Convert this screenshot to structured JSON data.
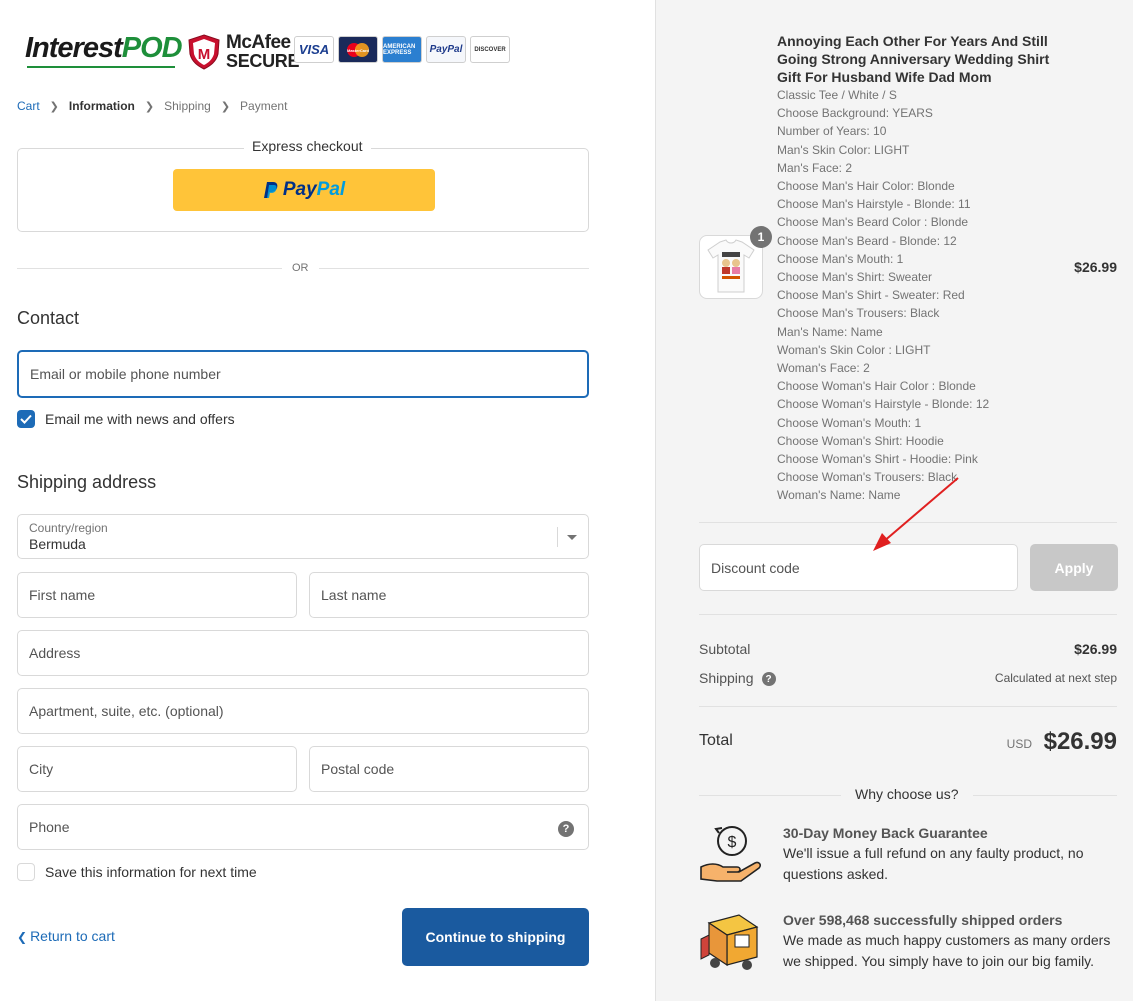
{
  "header": {
    "logo_main": "Interest",
    "logo_accent": "POD",
    "security_badge_line1": "McAfee",
    "security_badge_line2": "SECURE",
    "payment_cards": [
      "VISA",
      "MasterCard",
      "AMERICAN EXPRESS",
      "PayPal",
      "DISCOVER"
    ]
  },
  "breadcrumb": [
    {
      "label": "Cart",
      "state": "link"
    },
    {
      "label": "Information",
      "state": "active"
    },
    {
      "label": "Shipping",
      "state": "inactive"
    },
    {
      "label": "Payment",
      "state": "inactive"
    }
  ],
  "express": {
    "title": "Express checkout",
    "paypal_part1": "Pay",
    "paypal_part2": "Pal",
    "or_text": "OR"
  },
  "contact": {
    "title": "Contact",
    "email_placeholder": "Email or mobile phone number",
    "news_label": "Email me with news and offers",
    "news_checked": true
  },
  "shipping": {
    "title": "Shipping address",
    "country_label": "Country/region",
    "country_value": "Bermuda",
    "first_name_placeholder": "First name",
    "last_name_placeholder": "Last name",
    "address_placeholder": "Address",
    "apartment_placeholder": "Apartment, suite, etc. (optional)",
    "city_placeholder": "City",
    "postal_placeholder": "Postal code",
    "phone_placeholder": "Phone",
    "save_label": "Save this information for next time",
    "save_checked": false
  },
  "footer_actions": {
    "return_label": "Return to cart",
    "continue_label": "Continue to shipping"
  },
  "order": {
    "quantity": "1",
    "product_name": "Annoying Each Other For Years And Still Going Strong Anniversary Wedding Shirt Gift For Husband Wife Dad Mom",
    "variant_lines": [
      "Classic Tee / White / S",
      "Choose Background: YEARS",
      "Number of Years: 10",
      "Man's Skin Color: LIGHT",
      "Man's Face: 2",
      "Choose Man's Hair Color: Blonde",
      "Choose Man's Hairstyle - Blonde: 11",
      "Choose Man's Beard Color : Blonde",
      "Choose Man's Beard - Blonde: 12",
      "Choose Man's Mouth: 1",
      "Choose Man's Shirt: Sweater",
      "Choose Man's Shirt - Sweater: Red",
      "Choose Man's Trousers: Black",
      "Man's Name: Name",
      "Woman's Skin Color : LIGHT",
      "Woman's Face: 2",
      "Choose Woman's Hair Color : Blonde",
      "Choose Woman's Hairstyle - Blonde: 12",
      "Choose Woman's Mouth: 1",
      "Choose Woman's Shirt: Hoodie",
      "Choose Woman's Shirt - Hoodie: Pink",
      "Choose Woman's Trousers: Black",
      "Woman's Name: Name"
    ],
    "price": "$26.99",
    "discount_placeholder": "Discount code",
    "apply_label": "Apply",
    "subtotal_label": "Subtotal",
    "subtotal_value": "$26.99",
    "shipping_label": "Shipping",
    "shipping_value": "Calculated at next step",
    "total_label": "Total",
    "total_currency": "USD",
    "total_value": "$26.99"
  },
  "why": {
    "title": "Why choose us?",
    "benefits": [
      {
        "icon": "money-back-hand-icon",
        "title": "30-Day Money Back Guarantee",
        "text": "We'll issue a full refund on any faulty product, no questions asked."
      },
      {
        "icon": "delivery-truck-icon",
        "title": "Over 598,468 successfully shipped orders",
        "text": "We made as much happy customers as many orders we shipped. You simply have to join our big family."
      }
    ]
  },
  "colors": {
    "accent": "#1d6bb7",
    "primary_button": "#1a5a9f",
    "paypal_yellow": "#ffc439",
    "sidebar_bg": "#f4f4f4",
    "annotation_arrow": "#e02020"
  }
}
